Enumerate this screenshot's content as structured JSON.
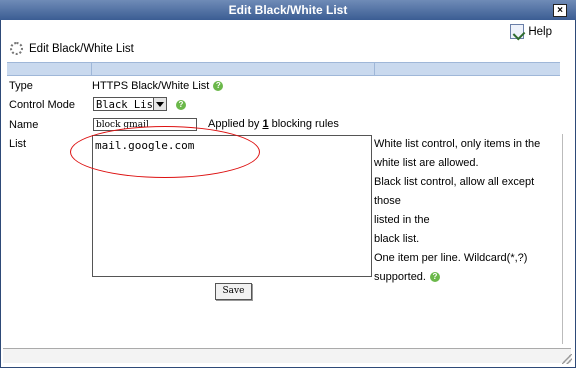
{
  "window": {
    "title": "Edit Black/White List",
    "close_label": "×"
  },
  "help": {
    "label": "Help"
  },
  "pane": {
    "title": "Edit Black/White List"
  },
  "form": {
    "type_label": "Type",
    "type_value": "HTTPS Black/White List",
    "control_mode_label": "Control Mode",
    "control_mode_value": "Black List",
    "name_label": "Name",
    "name_value": "block gmail",
    "applied_prefix": "Applied by",
    "applied_count": "1",
    "applied_suffix": "blocking rules",
    "list_label": "List",
    "list_value": "mail.google.com",
    "description": [
      "White list control, only items in the",
      "white list are allowed.",
      "Black list control, allow all except those",
      "listed in the",
      "black list.",
      "One item per line. Wildcard(*,?)",
      "supported."
    ],
    "help_glyph": "?"
  },
  "save_label": "Save",
  "colors": {
    "titlebar": "#3b5d93",
    "header_band": "#c9d9ee",
    "annotation": "#dd1111",
    "help_badge": "#6bb84a"
  },
  "icons": [
    "close-icon",
    "help-icon",
    "gear-icon",
    "question-icon",
    "dropdown-arrow-icon",
    "resize-grip-icon"
  ]
}
